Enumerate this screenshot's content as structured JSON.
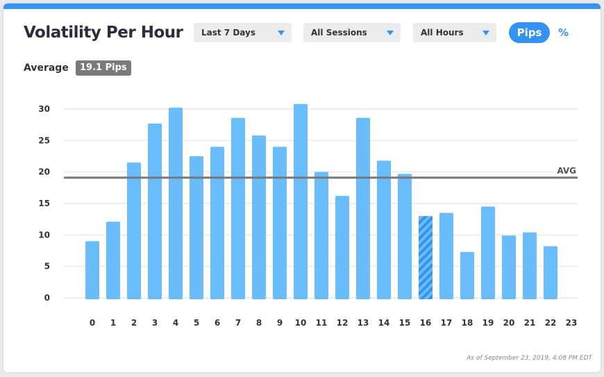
{
  "title": "Volatility Per Hour",
  "filters": {
    "period": "Last 7 Days",
    "session": "All Sessions",
    "hours": "All Hours"
  },
  "units": {
    "pips": "Pips",
    "percent": "%",
    "active": "Pips"
  },
  "average": {
    "label": "Average",
    "value_text": "19.1 Pips"
  },
  "footnote": "As of September 23, 2019, 4:08 PM EDT",
  "colors": {
    "accent": "#3592f0",
    "bar": "#69bdfc",
    "bar_highlight": "#3592f0",
    "avg_line": "#777777"
  },
  "chart_data": {
    "type": "bar",
    "categories": [
      "0",
      "1",
      "2",
      "3",
      "4",
      "5",
      "6",
      "7",
      "8",
      "9",
      "10",
      "11",
      "12",
      "13",
      "14",
      "15",
      "16",
      "17",
      "18",
      "19",
      "20",
      "21",
      "22",
      "23"
    ],
    "values": [
      9.0,
      12.1,
      21.5,
      27.7,
      30.2,
      22.5,
      24.0,
      28.6,
      25.8,
      24.0,
      30.8,
      20.0,
      16.2,
      28.6,
      21.8,
      19.7,
      13.0,
      13.5,
      7.3,
      14.5,
      9.9,
      10.4,
      8.2
    ],
    "highlight_index": 16,
    "average": 19.1,
    "average_label": "AVG",
    "ylim": [
      0,
      30
    ],
    "yticks": [
      0,
      5,
      10,
      15,
      20,
      25,
      30
    ],
    "grid": true
  }
}
